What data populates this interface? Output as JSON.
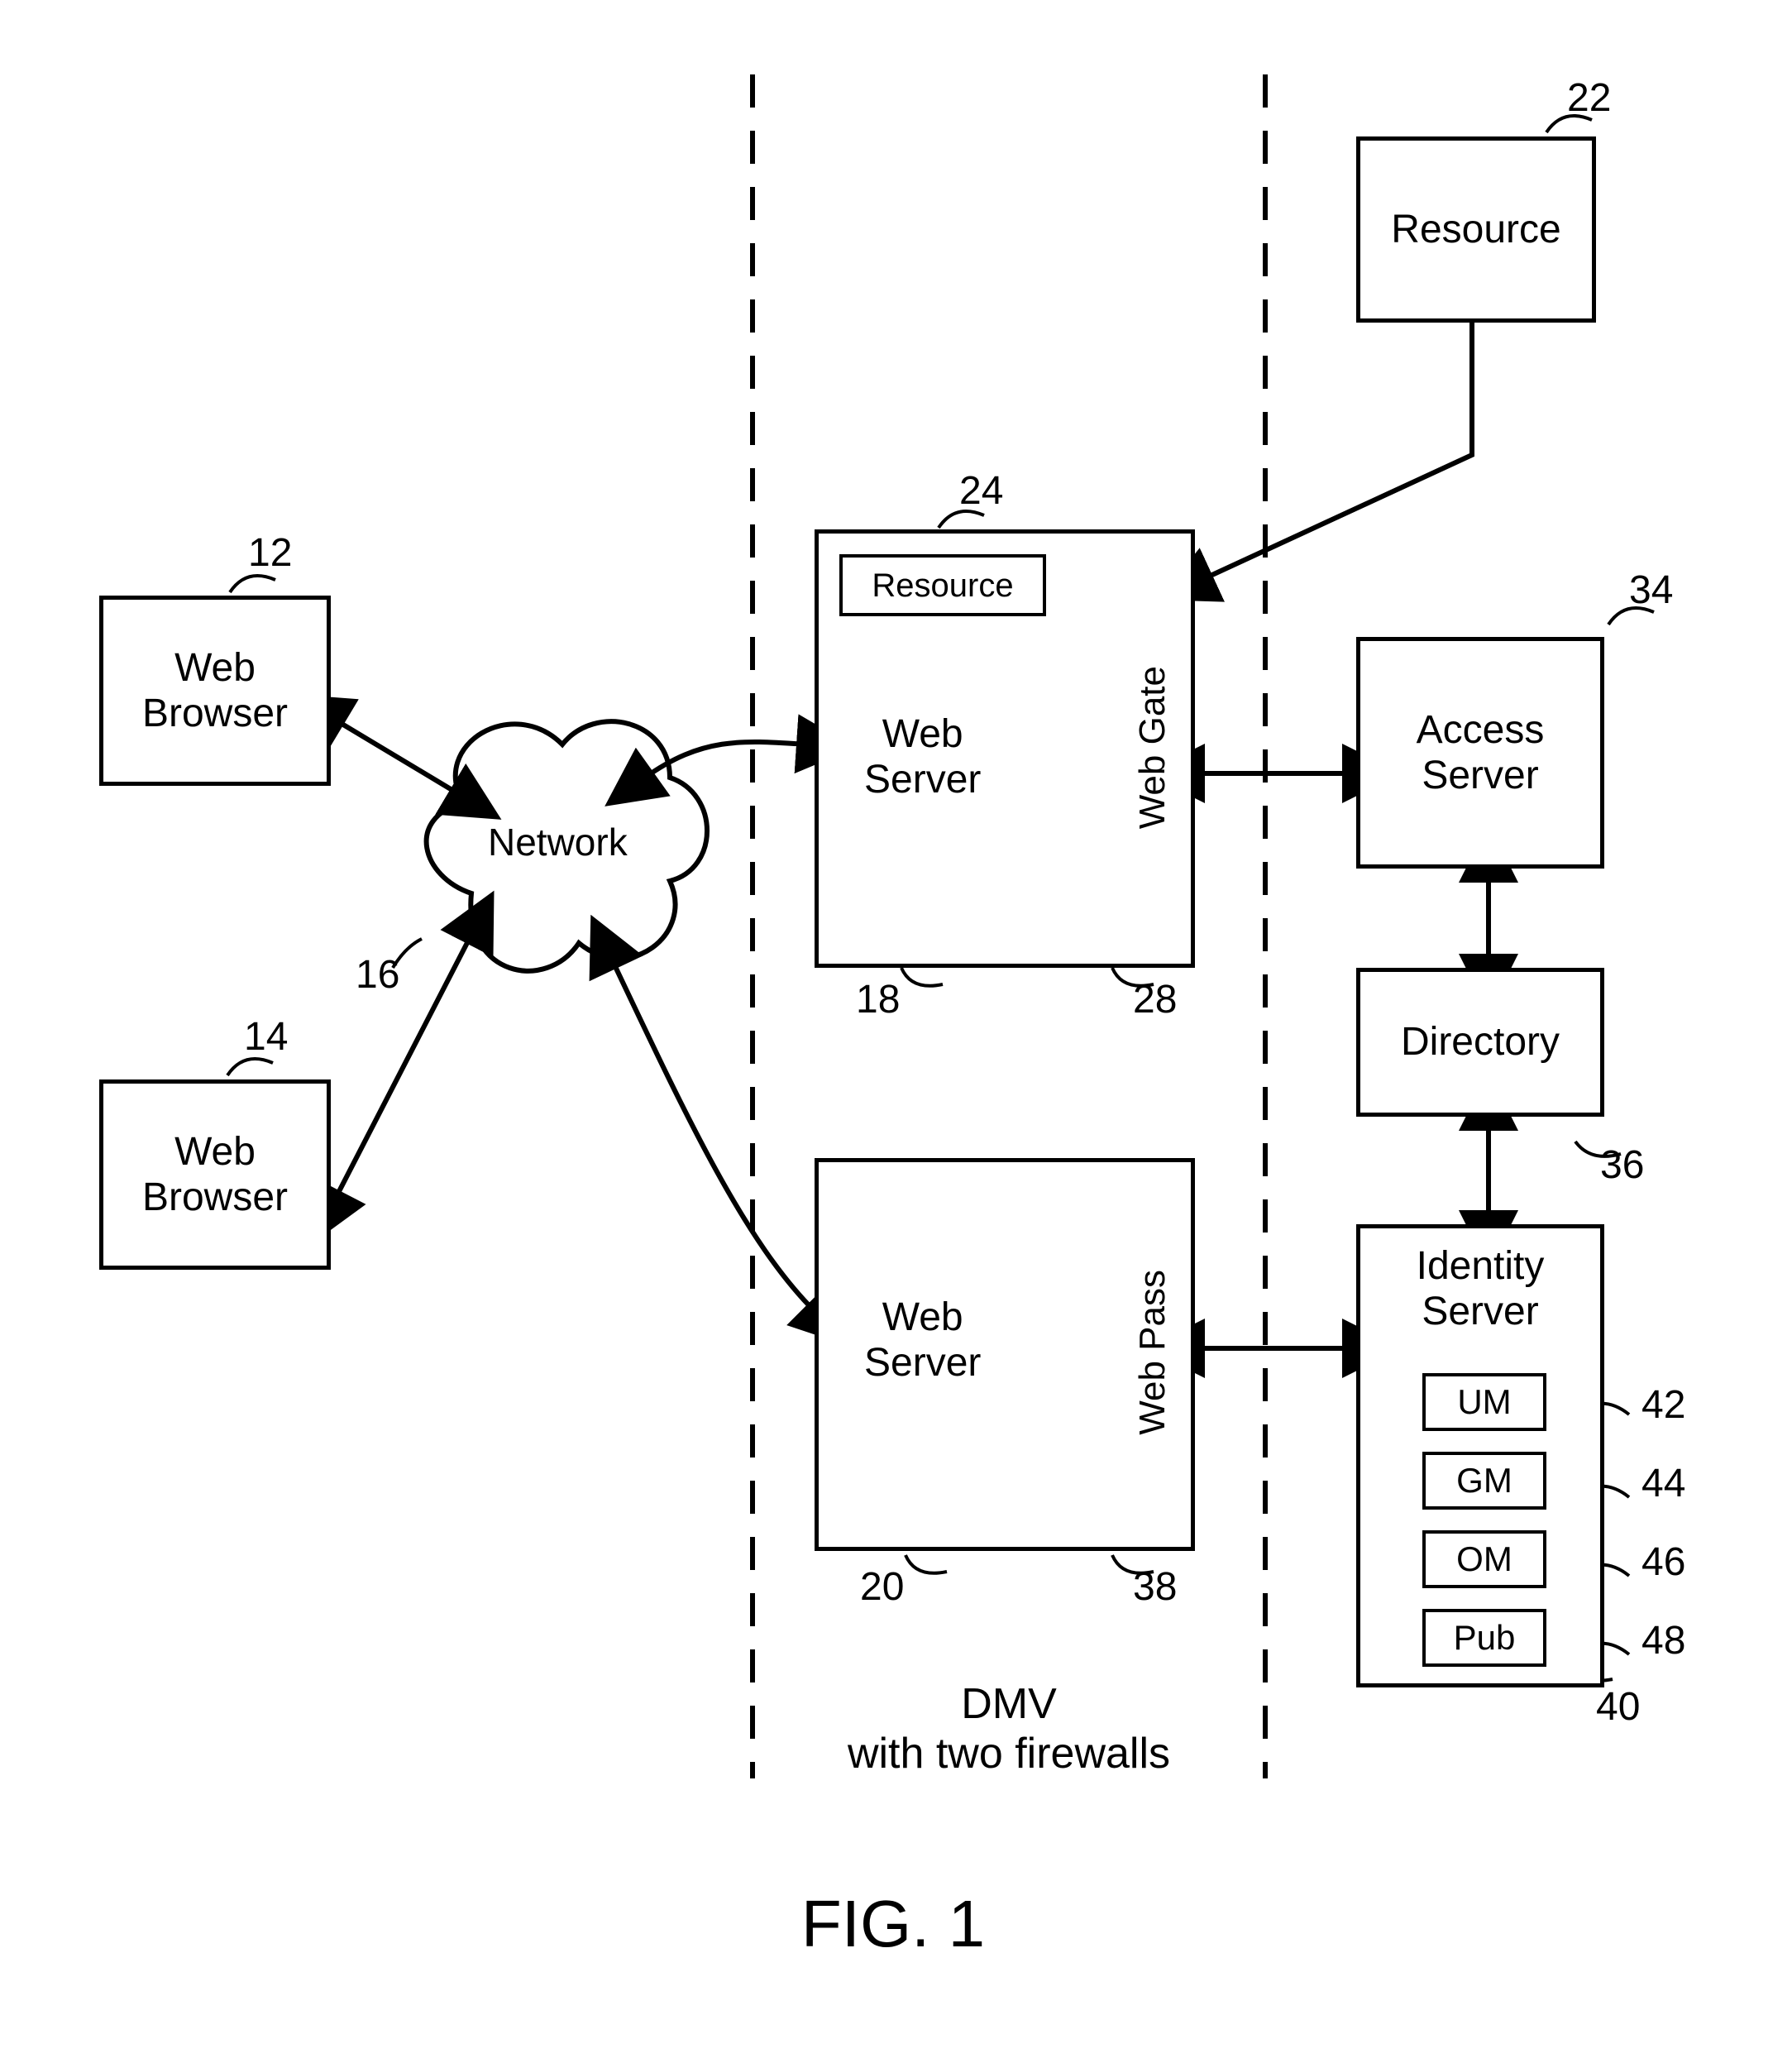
{
  "boxes": {
    "browser1": "Web\nBrowser",
    "browser2": "Web\nBrowser",
    "network": "Network",
    "resource22": "Resource",
    "webserver18": "Web\nServer",
    "resource24": "Resource",
    "webgate": "Web Gate",
    "webserver20": "Web\nServer",
    "webpass": "Web Pass",
    "access": "Access\nServer",
    "directory": "Directory",
    "identity": "Identity\nServer",
    "um": "UM",
    "gm": "GM",
    "om": "OM",
    "pub": "Pub"
  },
  "refs": {
    "r12": "12",
    "r14": "14",
    "r16": "16",
    "r18": "18",
    "r20": "20",
    "r22": "22",
    "r24": "24",
    "r28": "28",
    "r34": "34",
    "r36": "36",
    "r38": "38",
    "r40": "40",
    "r42": "42",
    "r44": "44",
    "r46": "46",
    "r48": "48"
  },
  "zone_caption": "DMV\nwith  two firewalls",
  "figure_label": "FIG. 1"
}
